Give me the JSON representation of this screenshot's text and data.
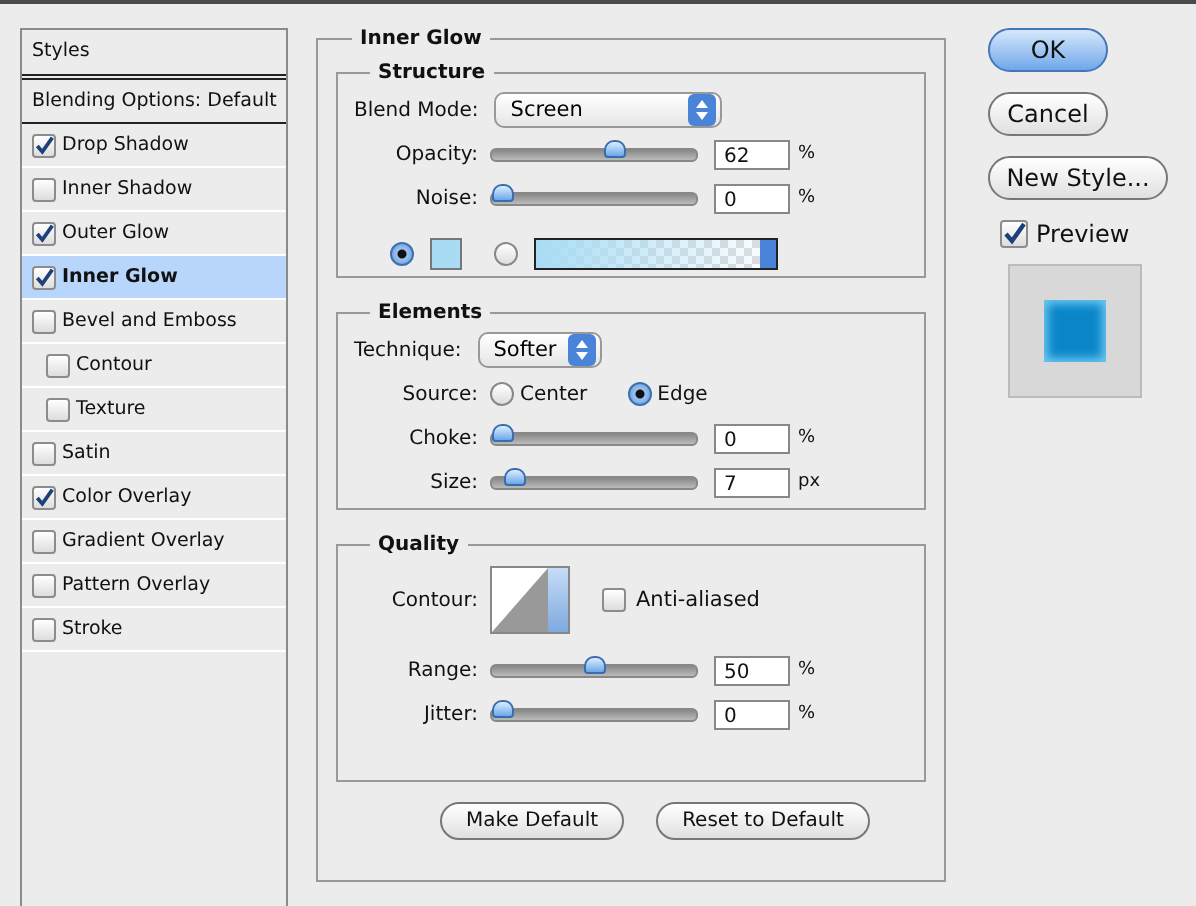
{
  "sidebar": {
    "title": "Styles",
    "blending_options": {
      "label": "Blending Options: Default",
      "selected": false
    },
    "items": [
      {
        "label": "Drop Shadow",
        "checked": true,
        "selected": false
      },
      {
        "label": "Inner Shadow",
        "checked": false,
        "selected": false
      },
      {
        "label": "Outer Glow",
        "checked": true,
        "selected": false
      },
      {
        "label": "Inner Glow",
        "checked": true,
        "selected": true
      },
      {
        "label": "Bevel and Emboss",
        "checked": false,
        "selected": false,
        "children": [
          {
            "label": "Contour",
            "checked": false,
            "selected": false
          },
          {
            "label": "Texture",
            "checked": false,
            "selected": false
          }
        ]
      },
      {
        "label": "Satin",
        "checked": false,
        "selected": false
      },
      {
        "label": "Color Overlay",
        "checked": true,
        "selected": false
      },
      {
        "label": "Gradient Overlay",
        "checked": false,
        "selected": false
      },
      {
        "label": "Pattern Overlay",
        "checked": false,
        "selected": false
      },
      {
        "label": "Stroke",
        "checked": false,
        "selected": false
      }
    ]
  },
  "panel": {
    "title": "Inner Glow",
    "structure": {
      "title": "Structure",
      "blend_mode": {
        "label": "Blend Mode:",
        "value": "Screen"
      },
      "sliders": [
        {
          "label": "Opacity:",
          "level": 0.62,
          "value": "62",
          "unit": "%"
        },
        {
          "label": "Noise:",
          "level": 0,
          "value": "0",
          "unit": "%"
        }
      ],
      "fill": [
        {
          "kind": "color",
          "selected": true
        },
        {
          "kind": "gradient",
          "selected": false
        }
      ]
    },
    "elements": {
      "title": "Elements",
      "technique": {
        "label": "Technique:",
        "value": "Softer"
      },
      "source": {
        "label": "Source:",
        "options": [
          {
            "label": "Center",
            "selected": false
          },
          {
            "label": "Edge",
            "selected": true
          }
        ]
      },
      "sliders": [
        {
          "label": "Choke:",
          "level": 0,
          "value": "0",
          "unit": "%"
        },
        {
          "label": "Size:",
          "level": 0.07,
          "value": "7",
          "unit": "px"
        }
      ]
    },
    "quality": {
      "title": "Quality",
      "contour_label": "Contour:",
      "anti_aliased": {
        "label": "Anti-aliased",
        "checked": false
      },
      "sliders": [
        {
          "label": "Range:",
          "level": 0.5,
          "value": "50",
          "unit": "%"
        },
        {
          "label": "Jitter:",
          "level": 0,
          "value": "0",
          "unit": "%"
        }
      ]
    },
    "buttons": [
      "Make Default",
      "Reset to Default"
    ]
  },
  "actions": [
    {
      "label": "OK",
      "kind": "default"
    },
    {
      "label": "Cancel",
      "kind": "normal"
    },
    {
      "label": "New Style...",
      "kind": "normal"
    }
  ],
  "preview": {
    "label": "Preview",
    "checked": true
  }
}
